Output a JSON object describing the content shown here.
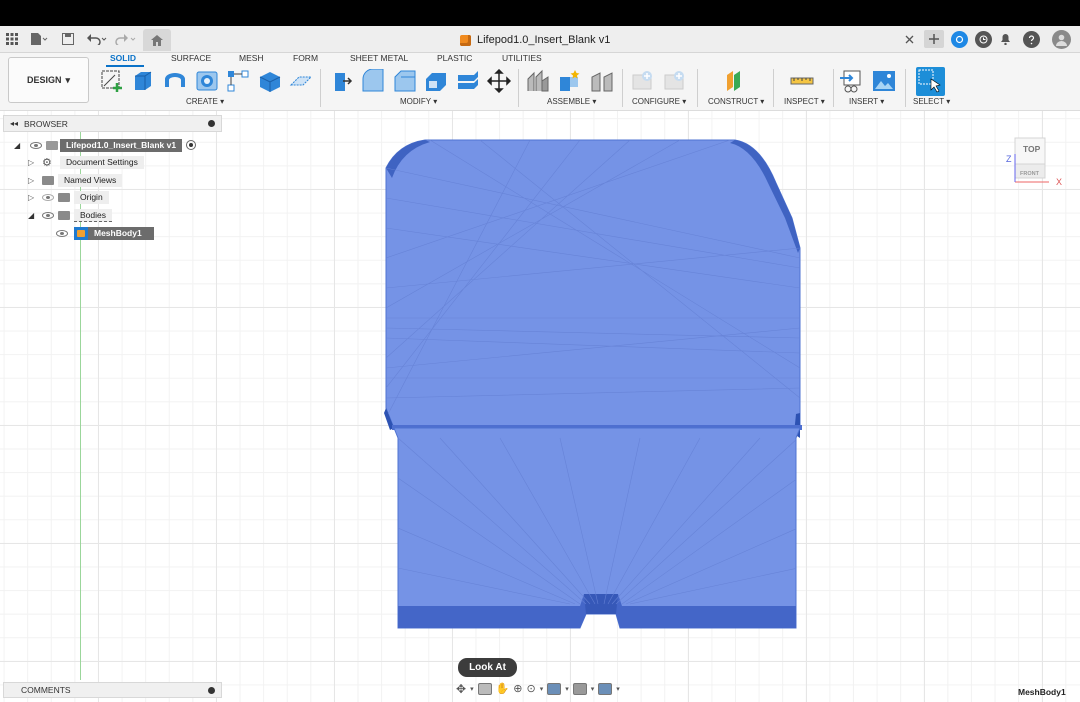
{
  "window": {
    "title": "Lifepod1.0_Insert_Blank v1"
  },
  "toolbar": {
    "workspace": "DESIGN",
    "tabs": [
      "SOLID",
      "SURFACE",
      "MESH",
      "FORM",
      "SHEET METAL",
      "PLASTIC",
      "UTILITIES"
    ],
    "groups": [
      "CREATE",
      "MODIFY",
      "ASSEMBLE",
      "CONFIGURE",
      "CONSTRUCT",
      "INSPECT",
      "INSERT",
      "SELECT"
    ],
    "accent": "#0a72c8"
  },
  "browser": {
    "header": "BROWSER",
    "root": "Lifepod1.0_Insert_Blank v1",
    "items": [
      {
        "label": "Document Settings"
      },
      {
        "label": "Named Views"
      },
      {
        "label": "Origin"
      },
      {
        "label": "Bodies"
      },
      {
        "label": "MeshBody1"
      }
    ]
  },
  "comments": {
    "label": "COMMENTS"
  },
  "viewcube": {
    "top": "TOP",
    "front": "FRONT",
    "axis_z": "Z",
    "axis_x": "X"
  },
  "viewport": {
    "tooltip": "Look At",
    "status_right": "MeshBody1",
    "mesh_color": "#7593e6"
  }
}
